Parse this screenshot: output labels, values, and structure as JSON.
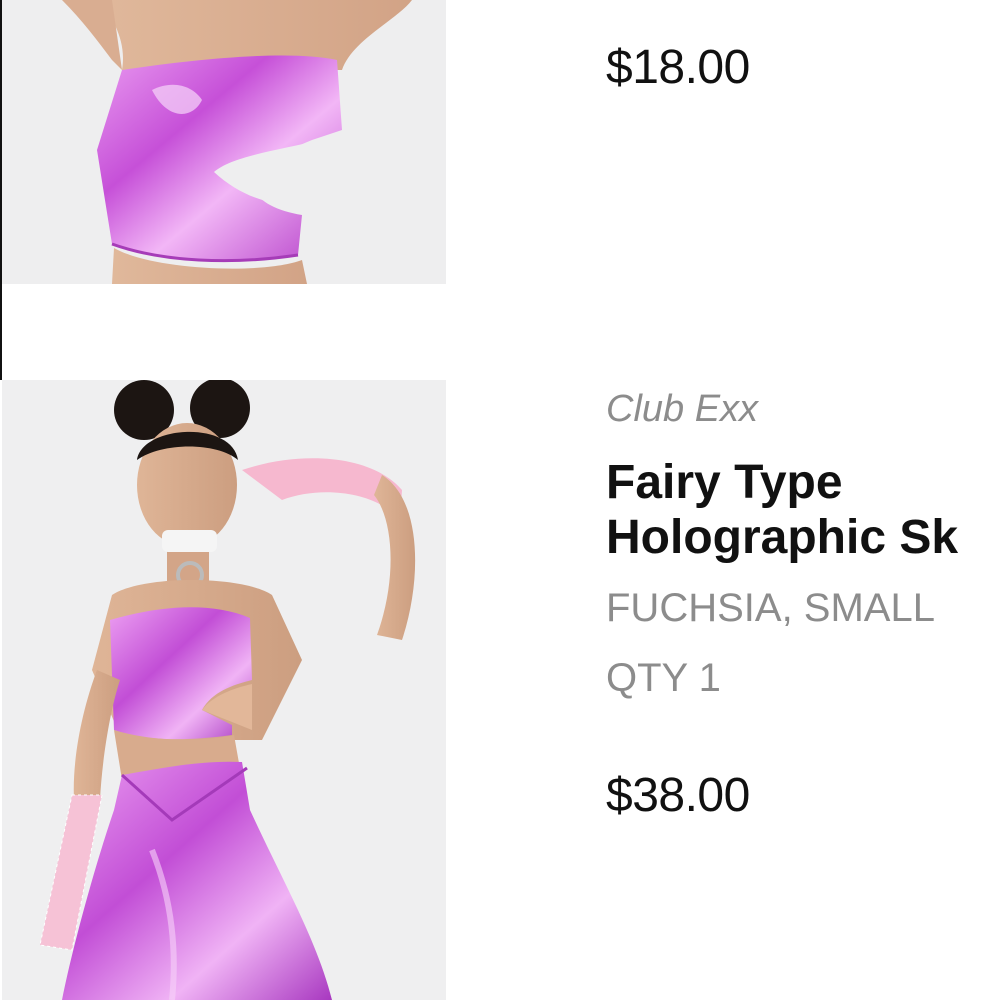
{
  "items": [
    {
      "image_alt": "Holographic fuchsia tube top",
      "price": "$18.00"
    },
    {
      "image_alt": "Model wearing holographic fuchsia top and skirt",
      "brand": "Club Exx",
      "title_line1": "Fairy Type",
      "title_line2": "Holographic Sk",
      "variant": "FUCHSIA, SMALL",
      "qty": "QTY 1",
      "price": "$38.00"
    }
  ],
  "colors": {
    "price_text": "#111111",
    "muted_text": "#8c8c8c",
    "accent_fuchsia": "#d468e0"
  }
}
